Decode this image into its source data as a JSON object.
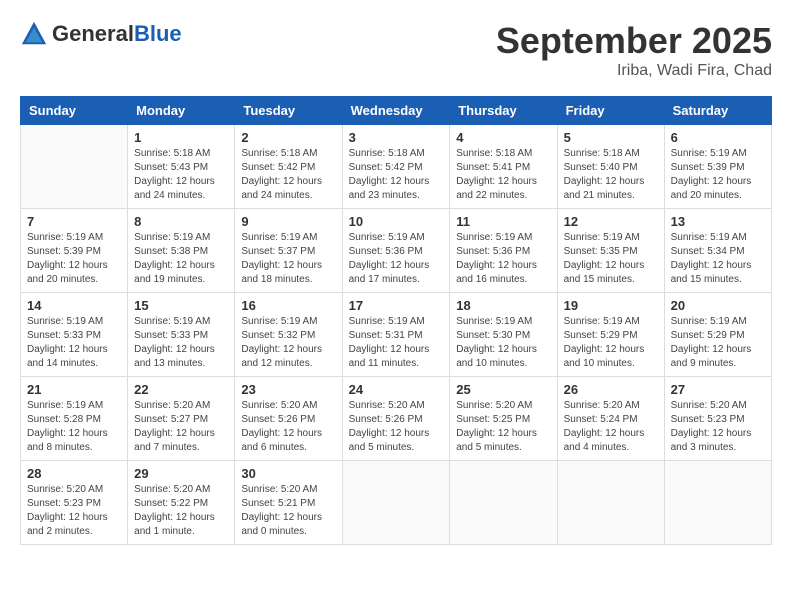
{
  "header": {
    "logo_general": "General",
    "logo_blue": "Blue",
    "month_title": "September 2025",
    "location": "Iriba, Wadi Fira, Chad"
  },
  "calendar": {
    "columns": [
      "Sunday",
      "Monday",
      "Tuesday",
      "Wednesday",
      "Thursday",
      "Friday",
      "Saturday"
    ],
    "weeks": [
      [
        {
          "day": "",
          "sunrise": "",
          "sunset": "",
          "daylight": ""
        },
        {
          "day": "1",
          "sunrise": "Sunrise: 5:18 AM",
          "sunset": "Sunset: 5:43 PM",
          "daylight": "Daylight: 12 hours and 24 minutes."
        },
        {
          "day": "2",
          "sunrise": "Sunrise: 5:18 AM",
          "sunset": "Sunset: 5:42 PM",
          "daylight": "Daylight: 12 hours and 24 minutes."
        },
        {
          "day": "3",
          "sunrise": "Sunrise: 5:18 AM",
          "sunset": "Sunset: 5:42 PM",
          "daylight": "Daylight: 12 hours and 23 minutes."
        },
        {
          "day": "4",
          "sunrise": "Sunrise: 5:18 AM",
          "sunset": "Sunset: 5:41 PM",
          "daylight": "Daylight: 12 hours and 22 minutes."
        },
        {
          "day": "5",
          "sunrise": "Sunrise: 5:18 AM",
          "sunset": "Sunset: 5:40 PM",
          "daylight": "Daylight: 12 hours and 21 minutes."
        },
        {
          "day": "6",
          "sunrise": "Sunrise: 5:19 AM",
          "sunset": "Sunset: 5:39 PM",
          "daylight": "Daylight: 12 hours and 20 minutes."
        }
      ],
      [
        {
          "day": "7",
          "sunrise": "Sunrise: 5:19 AM",
          "sunset": "Sunset: 5:39 PM",
          "daylight": "Daylight: 12 hours and 20 minutes."
        },
        {
          "day": "8",
          "sunrise": "Sunrise: 5:19 AM",
          "sunset": "Sunset: 5:38 PM",
          "daylight": "Daylight: 12 hours and 19 minutes."
        },
        {
          "day": "9",
          "sunrise": "Sunrise: 5:19 AM",
          "sunset": "Sunset: 5:37 PM",
          "daylight": "Daylight: 12 hours and 18 minutes."
        },
        {
          "day": "10",
          "sunrise": "Sunrise: 5:19 AM",
          "sunset": "Sunset: 5:36 PM",
          "daylight": "Daylight: 12 hours and 17 minutes."
        },
        {
          "day": "11",
          "sunrise": "Sunrise: 5:19 AM",
          "sunset": "Sunset: 5:36 PM",
          "daylight": "Daylight: 12 hours and 16 minutes."
        },
        {
          "day": "12",
          "sunrise": "Sunrise: 5:19 AM",
          "sunset": "Sunset: 5:35 PM",
          "daylight": "Daylight: 12 hours and 15 minutes."
        },
        {
          "day": "13",
          "sunrise": "Sunrise: 5:19 AM",
          "sunset": "Sunset: 5:34 PM",
          "daylight": "Daylight: 12 hours and 15 minutes."
        }
      ],
      [
        {
          "day": "14",
          "sunrise": "Sunrise: 5:19 AM",
          "sunset": "Sunset: 5:33 PM",
          "daylight": "Daylight: 12 hours and 14 minutes."
        },
        {
          "day": "15",
          "sunrise": "Sunrise: 5:19 AM",
          "sunset": "Sunset: 5:33 PM",
          "daylight": "Daylight: 12 hours and 13 minutes."
        },
        {
          "day": "16",
          "sunrise": "Sunrise: 5:19 AM",
          "sunset": "Sunset: 5:32 PM",
          "daylight": "Daylight: 12 hours and 12 minutes."
        },
        {
          "day": "17",
          "sunrise": "Sunrise: 5:19 AM",
          "sunset": "Sunset: 5:31 PM",
          "daylight": "Daylight: 12 hours and 11 minutes."
        },
        {
          "day": "18",
          "sunrise": "Sunrise: 5:19 AM",
          "sunset": "Sunset: 5:30 PM",
          "daylight": "Daylight: 12 hours and 10 minutes."
        },
        {
          "day": "19",
          "sunrise": "Sunrise: 5:19 AM",
          "sunset": "Sunset: 5:29 PM",
          "daylight": "Daylight: 12 hours and 10 minutes."
        },
        {
          "day": "20",
          "sunrise": "Sunrise: 5:19 AM",
          "sunset": "Sunset: 5:29 PM",
          "daylight": "Daylight: 12 hours and 9 minutes."
        }
      ],
      [
        {
          "day": "21",
          "sunrise": "Sunrise: 5:19 AM",
          "sunset": "Sunset: 5:28 PM",
          "daylight": "Daylight: 12 hours and 8 minutes."
        },
        {
          "day": "22",
          "sunrise": "Sunrise: 5:20 AM",
          "sunset": "Sunset: 5:27 PM",
          "daylight": "Daylight: 12 hours and 7 minutes."
        },
        {
          "day": "23",
          "sunrise": "Sunrise: 5:20 AM",
          "sunset": "Sunset: 5:26 PM",
          "daylight": "Daylight: 12 hours and 6 minutes."
        },
        {
          "day": "24",
          "sunrise": "Sunrise: 5:20 AM",
          "sunset": "Sunset: 5:26 PM",
          "daylight": "Daylight: 12 hours and 5 minutes."
        },
        {
          "day": "25",
          "sunrise": "Sunrise: 5:20 AM",
          "sunset": "Sunset: 5:25 PM",
          "daylight": "Daylight: 12 hours and 5 minutes."
        },
        {
          "day": "26",
          "sunrise": "Sunrise: 5:20 AM",
          "sunset": "Sunset: 5:24 PM",
          "daylight": "Daylight: 12 hours and 4 minutes."
        },
        {
          "day": "27",
          "sunrise": "Sunrise: 5:20 AM",
          "sunset": "Sunset: 5:23 PM",
          "daylight": "Daylight: 12 hours and 3 minutes."
        }
      ],
      [
        {
          "day": "28",
          "sunrise": "Sunrise: 5:20 AM",
          "sunset": "Sunset: 5:23 PM",
          "daylight": "Daylight: 12 hours and 2 minutes."
        },
        {
          "day": "29",
          "sunrise": "Sunrise: 5:20 AM",
          "sunset": "Sunset: 5:22 PM",
          "daylight": "Daylight: 12 hours and 1 minute."
        },
        {
          "day": "30",
          "sunrise": "Sunrise: 5:20 AM",
          "sunset": "Sunset: 5:21 PM",
          "daylight": "Daylight: 12 hours and 0 minutes."
        },
        {
          "day": "",
          "sunrise": "",
          "sunset": "",
          "daylight": ""
        },
        {
          "day": "",
          "sunrise": "",
          "sunset": "",
          "daylight": ""
        },
        {
          "day": "",
          "sunrise": "",
          "sunset": "",
          "daylight": ""
        },
        {
          "day": "",
          "sunrise": "",
          "sunset": "",
          "daylight": ""
        }
      ]
    ]
  }
}
